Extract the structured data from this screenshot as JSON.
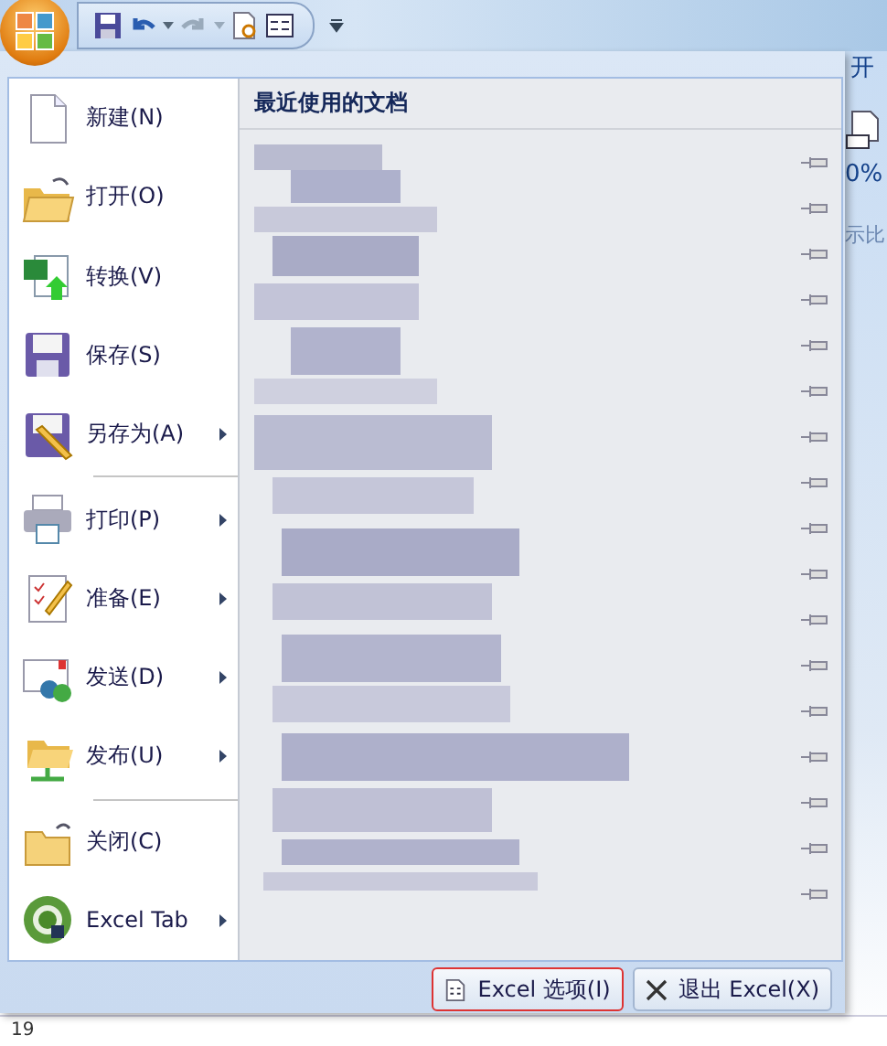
{
  "ribbon": {
    "tab": "开",
    "zoom": "0%",
    "group": "示比"
  },
  "menu": {
    "items": [
      {
        "label": "新建(N)",
        "submenu": false,
        "divider_after": false
      },
      {
        "label": "打开(O)",
        "submenu": false,
        "divider_after": false
      },
      {
        "label": "转换(V)",
        "submenu": false,
        "divider_after": false
      },
      {
        "label": "保存(S)",
        "submenu": false,
        "divider_after": false
      },
      {
        "label": "另存为(A)",
        "submenu": true,
        "divider_after": true
      },
      {
        "label": "打印(P)",
        "submenu": true,
        "divider_after": false
      },
      {
        "label": "准备(E)",
        "submenu": true,
        "divider_after": false
      },
      {
        "label": "发送(D)",
        "submenu": true,
        "divider_after": false
      },
      {
        "label": "发布(U)",
        "submenu": true,
        "divider_after": true
      },
      {
        "label": "关闭(C)",
        "submenu": false,
        "divider_after": false
      },
      {
        "label": "Excel Tab",
        "submenu": true,
        "divider_after": false
      }
    ],
    "recent_title": "最近使用的文档",
    "buttons": [
      {
        "label": "Excel 选项(I)",
        "kind": "options"
      },
      {
        "label": "退出 Excel(X)",
        "kind": "exit"
      }
    ]
  },
  "sheet": {
    "row": "19"
  }
}
